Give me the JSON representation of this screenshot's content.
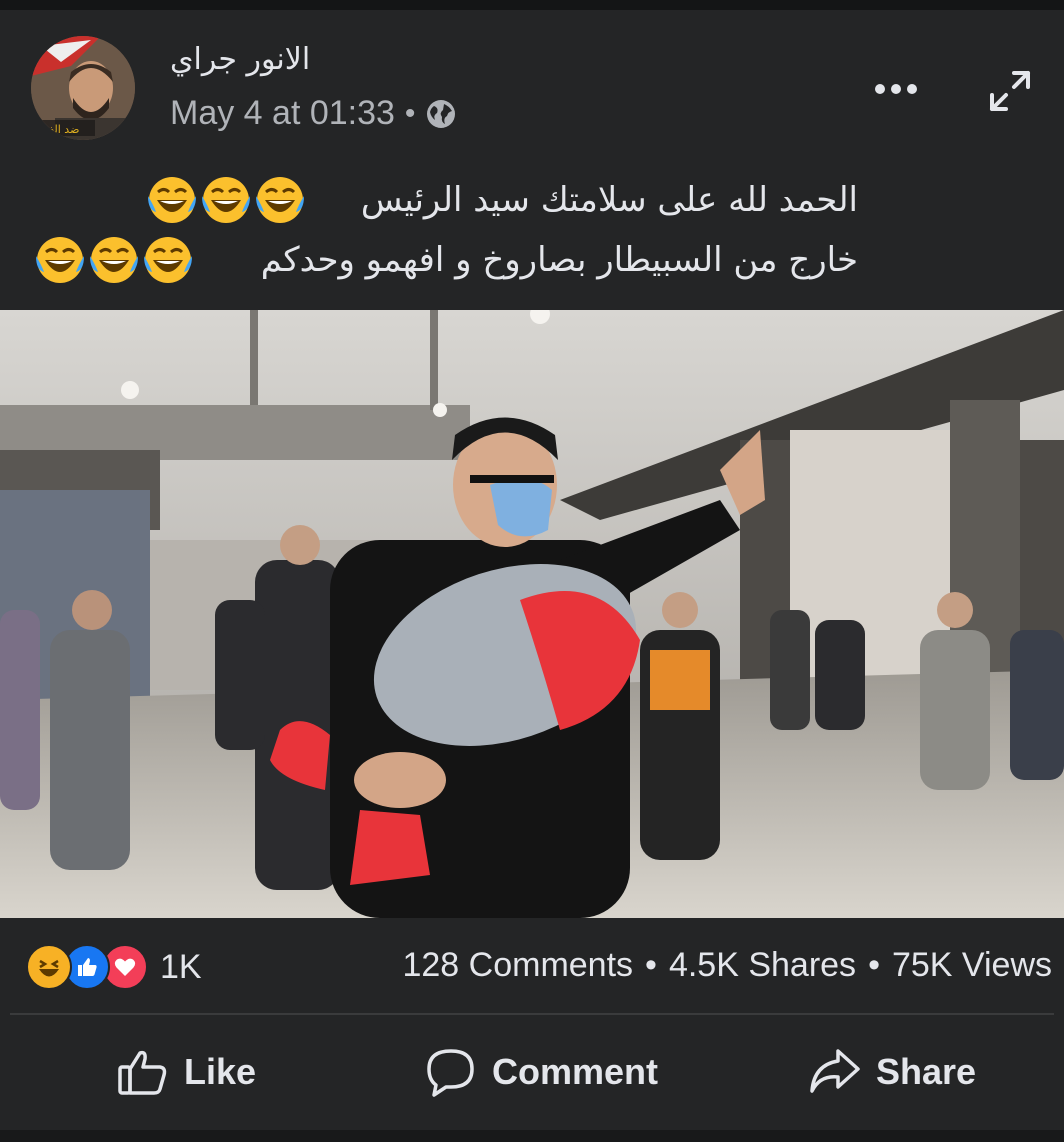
{
  "post": {
    "author": "الانور جراي",
    "timestamp": "May 4 at 01:33",
    "separator": "•",
    "privacy_icon": "globe-icon",
    "caption_line1": "الحمد لله على سلامتك سيد الرئيس",
    "caption_line2": "خارج من السبيطار بصاروخ و افهمو وحدكم",
    "caption_emoji": "laughing-tears-emoji"
  },
  "stats": {
    "reaction_count": "1K",
    "comments": "128 Comments",
    "shares": "4.5K Shares",
    "views": "75K Views",
    "sep": "•",
    "reaction_icons": [
      "haha-icon",
      "like-icon",
      "love-icon"
    ]
  },
  "actions": {
    "like_label": "Like",
    "comment_label": "Comment",
    "share_label": "Share"
  },
  "colors": {
    "background": "#242526",
    "text": "#e4e6eb",
    "secondary": "#b0b3b8",
    "like_blue": "#1877f2",
    "love_red": "#f33e58",
    "haha_yellow": "#f7b125"
  }
}
